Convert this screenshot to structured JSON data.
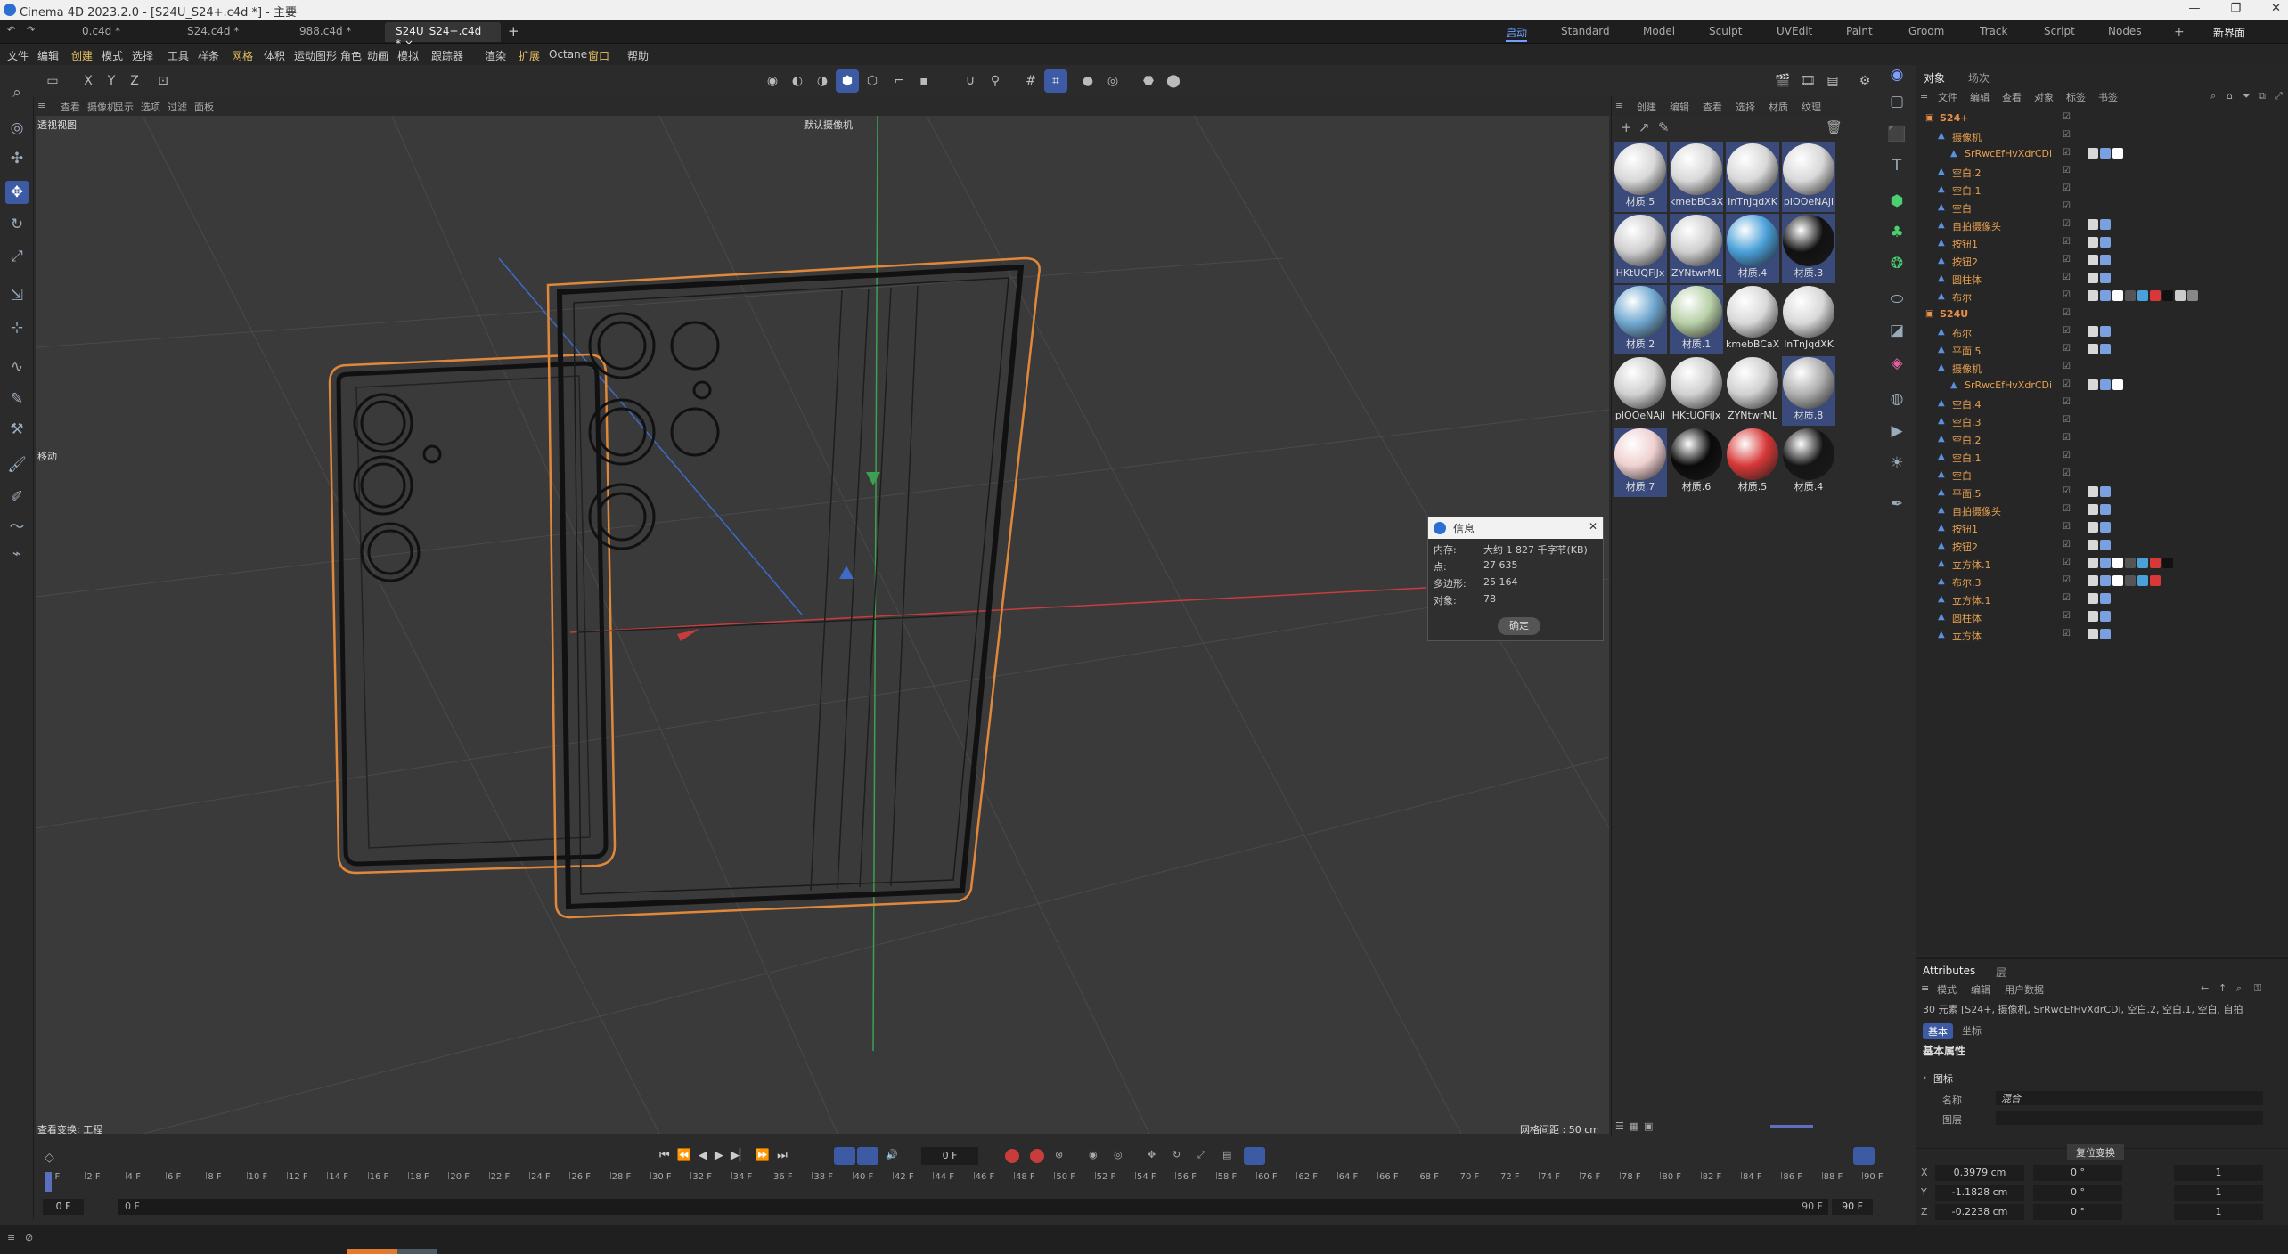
{
  "window": {
    "title": "Cinema 4D 2023.2.0 - [S24U_S24+.c4d *] - 主要"
  },
  "doc_tabs": [
    "0.c4d *",
    "S24.c4d *",
    "988.c4d *",
    "S24U_S24+.c4d *"
  ],
  "layout_tabs": [
    "启动",
    "Standard",
    "Model",
    "Sculpt",
    "UVEdit",
    "Paint",
    "Groom",
    "Track",
    "Script",
    "Nodes",
    "新界面"
  ],
  "menu": [
    "文件",
    "编辑",
    "创建",
    "模式",
    "选择",
    "工具",
    "样条",
    "网格",
    "体积",
    "运动图形",
    "角色",
    "动画",
    "模拟",
    "跟踪器",
    "渲染",
    "扩展",
    "Octane",
    "窗口",
    "帮助"
  ],
  "axis_buttons": [
    "X",
    "Y",
    "Z"
  ],
  "viewport_menu": [
    "查看",
    "摄像机",
    "显示",
    "选项",
    "过滤",
    "面板"
  ],
  "viewport": {
    "label": "透视视图",
    "camera": "默认摄像机",
    "move_hint": "移动",
    "status_left": "查看变换: 工程",
    "grid_spacing": "网格间距 : 50 cm"
  },
  "materials_menu": [
    "创建",
    "编辑",
    "查看",
    "选择",
    "材质",
    "纹理"
  ],
  "materials": [
    {
      "name": "材质.5",
      "color": "#d8d8d8",
      "sel": true
    },
    {
      "name": "kmebBCaX",
      "color": "#d8d8d8",
      "sel": true
    },
    {
      "name": "InTnJqdXK",
      "color": "#d8d8d8",
      "sel": true
    },
    {
      "name": "pIOOeNAjI",
      "color": "#d8d8d8",
      "sel": true
    },
    {
      "name": "HKtUQFiJx",
      "color": "#cfcfcf",
      "sel": true
    },
    {
      "name": "ZYNtwrML",
      "color": "#cfcfcf",
      "sel": true
    },
    {
      "name": "材质.4",
      "color": "#4aa0d8",
      "sel": true
    },
    {
      "name": "材质.3",
      "color": "#111111",
      "sel": true
    },
    {
      "name": "材质.2",
      "color": "#70a8d0",
      "sel": true
    },
    {
      "name": "材质.1",
      "color": "#b8d0a8",
      "sel": true
    },
    {
      "name": "kmebBCaX",
      "color": "#d8d8d8",
      "sel": false
    },
    {
      "name": "InTnJqdXK",
      "color": "#d8d8d8",
      "sel": false
    },
    {
      "name": "pIOOeNAjI",
      "color": "#d0d0d0",
      "sel": false
    },
    {
      "name": "HKtUQFiJx",
      "color": "#d0d0d0",
      "sel": false
    },
    {
      "name": "ZYNtwrML",
      "color": "#d0d0d0",
      "sel": false
    },
    {
      "name": "材质.8",
      "color": "#b0b0b0",
      "sel": true
    },
    {
      "name": "材质.7",
      "color": "#f0d0d0",
      "sel": true
    },
    {
      "name": "材质.6",
      "color": "#0a0a0a",
      "sel": false
    },
    {
      "name": "材质.5",
      "color": "#d83838",
      "sel": false
    },
    {
      "name": "材质.4",
      "color": "#151515",
      "sel": false
    }
  ],
  "objects_panel": {
    "tabs": [
      "对象",
      "场次"
    ],
    "menu": [
      "文件",
      "编辑",
      "查看",
      "对象",
      "标签",
      "书签"
    ]
  },
  "objects": [
    {
      "name": "S24+",
      "indent": 0,
      "top": true,
      "tags": 0
    },
    {
      "name": "摄像机",
      "indent": 1,
      "top": false,
      "tags": 0
    },
    {
      "name": "SrRwcEfHvXdrCDi",
      "indent": 2,
      "top": false,
      "tags": 3
    },
    {
      "name": "空白.2",
      "indent": 1,
      "top": false,
      "tags": 0
    },
    {
      "name": "空白.1",
      "indent": 1,
      "top": false,
      "tags": 0
    },
    {
      "name": "空白",
      "indent": 1,
      "top": false,
      "tags": 0
    },
    {
      "name": "自拍摄像头",
      "indent": 1,
      "top": false,
      "tags": 2
    },
    {
      "name": "按钮1",
      "indent": 1,
      "top": false,
      "tags": 2
    },
    {
      "name": "按钮2",
      "indent": 1,
      "top": false,
      "tags": 2
    },
    {
      "name": "圆柱体",
      "indent": 1,
      "top": false,
      "tags": 2
    },
    {
      "name": "布尔",
      "indent": 1,
      "top": false,
      "tags": 9
    },
    {
      "name": "S24U",
      "indent": 0,
      "top": true,
      "tags": 0
    },
    {
      "name": "布尔",
      "indent": 1,
      "top": false,
      "tags": 2
    },
    {
      "name": "平面.5",
      "indent": 1,
      "top": false,
      "tags": 2
    },
    {
      "name": "摄像机",
      "indent": 1,
      "top": false,
      "tags": 0
    },
    {
      "name": "SrRwcEfHvXdrCDi",
      "indent": 2,
      "top": false,
      "tags": 3
    },
    {
      "name": "空白.4",
      "indent": 1,
      "top": false,
      "tags": 0
    },
    {
      "name": "空白.3",
      "indent": 1,
      "top": false,
      "tags": 0
    },
    {
      "name": "空白.2",
      "indent": 1,
      "top": false,
      "tags": 0
    },
    {
      "name": "空白.1",
      "indent": 1,
      "top": false,
      "tags": 0
    },
    {
      "name": "空白",
      "indent": 1,
      "top": false,
      "tags": 0
    },
    {
      "name": "平面.5",
      "indent": 1,
      "top": false,
      "tags": 2
    },
    {
      "name": "自拍摄像头",
      "indent": 1,
      "top": false,
      "tags": 2
    },
    {
      "name": "按钮1",
      "indent": 1,
      "top": false,
      "tags": 2
    },
    {
      "name": "按钮2",
      "indent": 1,
      "top": false,
      "tags": 2
    },
    {
      "name": "立方体.1",
      "indent": 1,
      "top": false,
      "tags": 7
    },
    {
      "name": "布尔.3",
      "indent": 1,
      "top": false,
      "tags": 6
    },
    {
      "name": "立方体.1",
      "indent": 1,
      "top": false,
      "tags": 2
    },
    {
      "name": "圆柱体",
      "indent": 1,
      "top": false,
      "tags": 2
    },
    {
      "name": "立方体",
      "indent": 1,
      "top": false,
      "tags": 2
    }
  ],
  "attributes": {
    "tabs": [
      "Attributes",
      "层"
    ],
    "menu": [
      "模式",
      "编辑",
      "用户数据"
    ],
    "selection": "30 元素 [S24+, 摄像机, SrRwcEfHvXdrCDi, 空白.2, 空白.1, 空白, 自拍",
    "sub_tabs": [
      "基本",
      "坐标"
    ],
    "section": "基本属性",
    "group": "图标",
    "name_label": "名称",
    "name_value": "混合",
    "layer_label": "图层"
  },
  "coords": {
    "reset": "复位变换",
    "rows": [
      {
        "axis": "X",
        "pos": "0.3979 cm",
        "rot": "0 °",
        "scale": "1"
      },
      {
        "axis": "Y",
        "pos": "-1.1828 cm",
        "rot": "0 °",
        "scale": "1"
      },
      {
        "axis": "Z",
        "pos": "-0.2238 cm",
        "rot": "0 °",
        "scale": "1"
      }
    ]
  },
  "info_dialog": {
    "title": "信息",
    "rows": [
      {
        "k": "内存:",
        "v": "大约 1 827 千字节(KB)"
      },
      {
        "k": "点:",
        "v": "27 635"
      },
      {
        "k": "多边形:",
        "v": "25 164"
      },
      {
        "k": "对象:",
        "v": "78"
      }
    ],
    "ok": "确定"
  },
  "timeline": {
    "current_frame": "0 F",
    "ticks": [
      "0 F",
      "2 F",
      "4 F",
      "6 F",
      "8 F",
      "10 F",
      "12 F",
      "14 F",
      "16 F",
      "18 F",
      "20 F",
      "22 F",
      "24 F",
      "26 F",
      "28 F",
      "30 F",
      "32 F",
      "34 F",
      "36 F",
      "38 F",
      "40 F",
      "42 F",
      "44 F",
      "46 F",
      "48 F",
      "50 F",
      "52 F",
      "54 F",
      "56 F",
      "58 F",
      "60 F",
      "62 F",
      "64 F",
      "66 F",
      "68 F",
      "70 F",
      "72 F",
      "74 F",
      "76 F",
      "78 F",
      "80 F",
      "82 F",
      "84 F",
      "86 F",
      "88 F",
      "90 F"
    ],
    "start": "0 F",
    "start2": "0 F",
    "end": "90 F",
    "end2": "90 F"
  }
}
